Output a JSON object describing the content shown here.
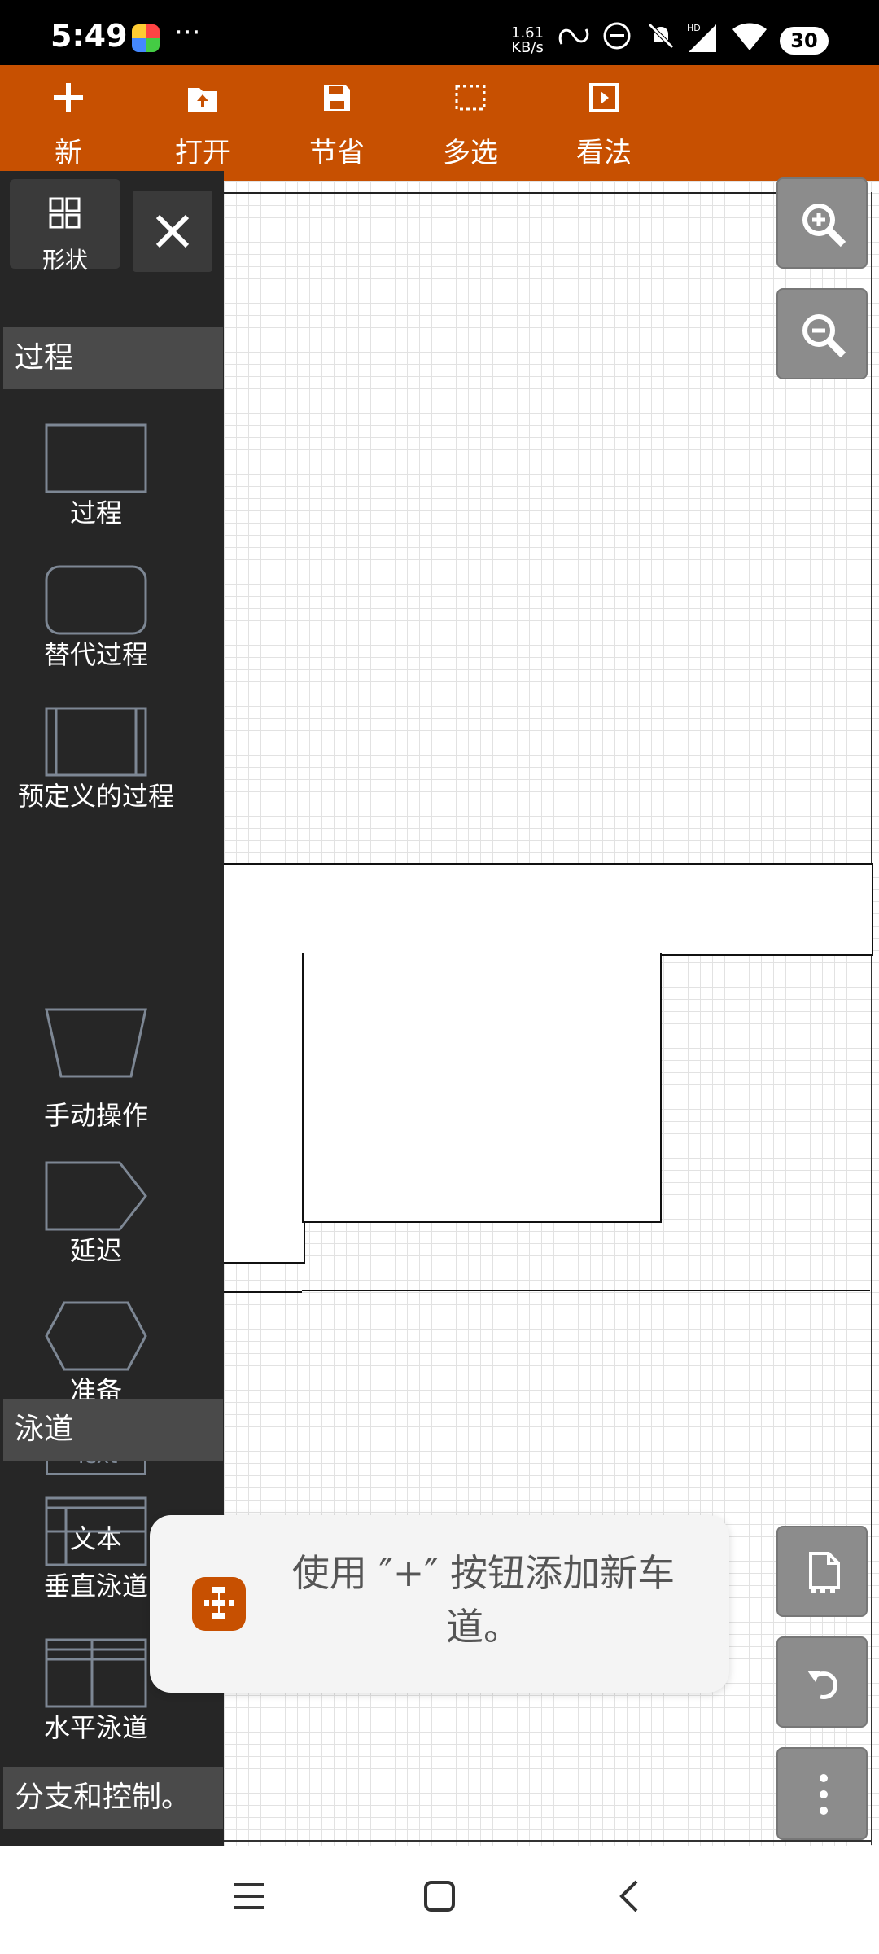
{
  "status_bar": {
    "time": "5:49",
    "dots": "···",
    "net_speed_value": "1.61",
    "net_speed_unit": "KB/s",
    "battery": "30"
  },
  "toolbar": {
    "new": "新",
    "open": "打开",
    "save": "节省",
    "multiselect": "多选",
    "view": "看法"
  },
  "sidebar": {
    "shapes_label": "形状",
    "sections": {
      "process": "过程",
      "swimlanes": "泳道",
      "branch": "分支和控制。"
    },
    "items": [
      {
        "label": "过程"
      },
      {
        "label": "替代过程"
      },
      {
        "label": "预定义的过程"
      },
      {
        "label": "手动操作"
      },
      {
        "label": "延迟"
      },
      {
        "label": "准备"
      },
      {
        "label": "文本",
        "placeholder": "Text"
      },
      {
        "label": "垂直泳道"
      },
      {
        "label": "水平泳道"
      }
    ]
  },
  "toast": {
    "message": "使用 ″+″ 按钮添加新车道。"
  },
  "colors": {
    "accent": "#c75001",
    "sidebar_bg": "#262626",
    "fab_bg": "#8c8c8c"
  },
  "icons": [
    "zoom-in-icon",
    "zoom-out-icon",
    "page-icon",
    "undo-icon",
    "more-vert-icon"
  ]
}
